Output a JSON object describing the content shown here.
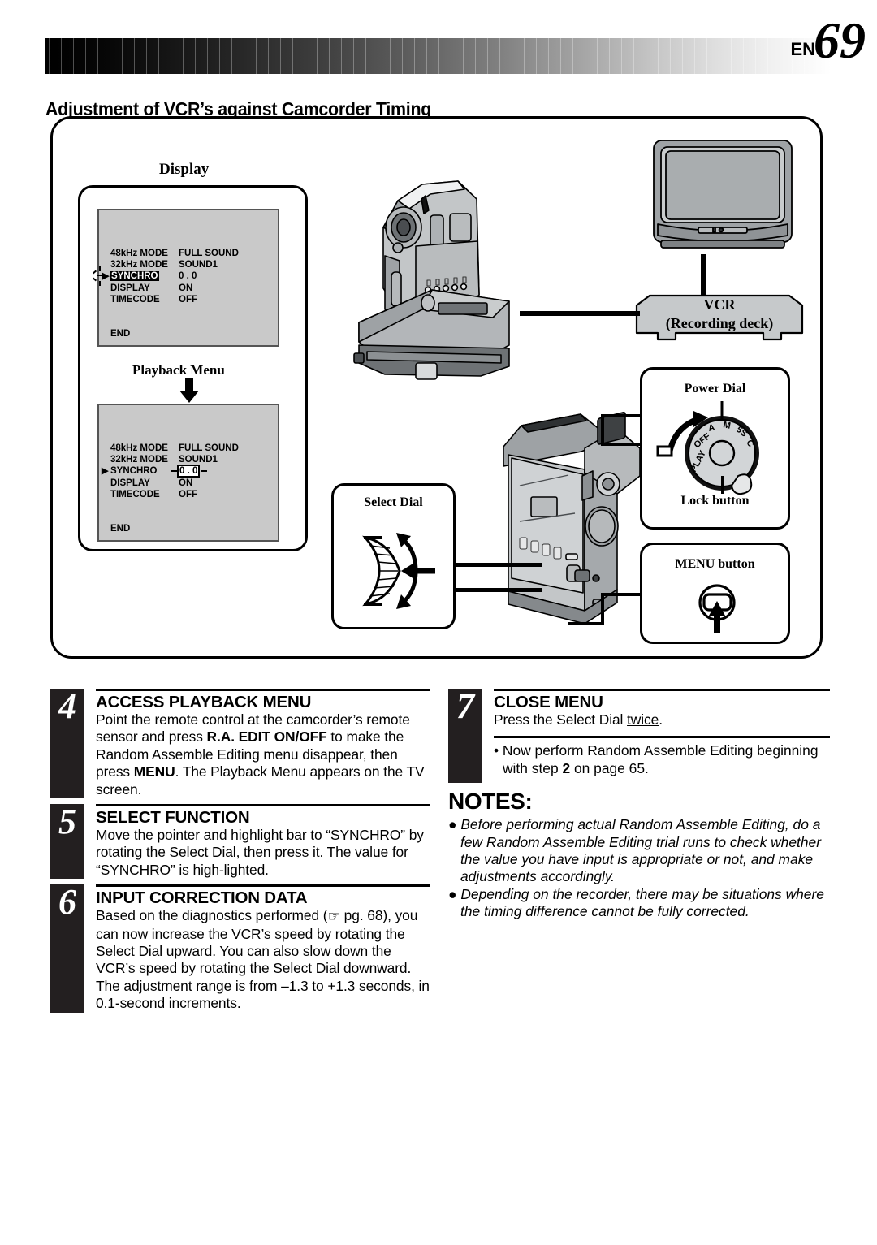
{
  "header": {
    "en_label": "EN",
    "page_number": "69",
    "section_title": "Adjustment of VCR’s against Camcorder Timing"
  },
  "illustration": {
    "display_label": "Display",
    "playback_menu_label": "Playback Menu",
    "osd_display": {
      "rows": [
        {
          "label": "48kHz  MODE",
          "value": "FULL SOUND",
          "state": "normal"
        },
        {
          "label": "32kHz  MODE",
          "value": "SOUND1",
          "state": "normal"
        },
        {
          "label": "SYNCHRO",
          "value": "0 . 0",
          "state": "highlighted-label"
        },
        {
          "label": "DISPLAY",
          "value": "ON",
          "state": "normal"
        },
        {
          "label": "TIMECODE",
          "value": "OFF",
          "state": "normal"
        }
      ],
      "end_label": "END",
      "pointer_row": 2
    },
    "osd_playback": {
      "rows": [
        {
          "label": "48kHz  MODE",
          "value": "FULL SOUND",
          "state": "normal"
        },
        {
          "label": "32kHz  MODE",
          "value": "SOUND1",
          "state": "normal"
        },
        {
          "label": "SYNCHRO",
          "value": "0 . 0",
          "state": "boxed-value"
        },
        {
          "label": "DISPLAY",
          "value": "ON",
          "state": "normal"
        },
        {
          "label": "TIMECODE",
          "value": "OFF",
          "state": "normal"
        }
      ],
      "end_label": "END",
      "pointer_row": 2
    },
    "vcr_line1": "VCR",
    "vcr_line2": "(Recording deck)",
    "power_dial_label": "Power Dial",
    "lock_button_label": "Lock button",
    "menu_button_label": "MENU button",
    "select_dial_label": "Select Dial",
    "power_dial_positions": [
      "PLAY",
      "OFF",
      "A",
      "M",
      "5S",
      "C"
    ],
    "colors": {
      "device_body": "#b0b3b5",
      "device_dark": "#7b7f82",
      "osd_bg": "#c9c9c9"
    }
  },
  "steps": [
    {
      "number": "4",
      "title": "ACCESS PLAYBACK MENU",
      "body_parts": [
        {
          "t": "Point the remote control at the camcorder’s remote sensor and press ",
          "b": false
        },
        {
          "t": "R.A. EDIT ON/OFF",
          "b": true
        },
        {
          "t": " to make the Random Assemble Editing menu disappear, then press ",
          "b": false
        },
        {
          "t": "MENU",
          "b": true
        },
        {
          "t": ". The Playback Menu appears on the TV screen.",
          "b": false
        }
      ]
    },
    {
      "number": "5",
      "title": "SELECT FUNCTION",
      "body_parts": [
        {
          "t": "Move the pointer and highlight bar to “SYNCHRO” by rotating the Select Dial, then press it. The value for “SYNCHRO” is high-lighted.",
          "b": false
        }
      ]
    },
    {
      "number": "6",
      "title": "INPUT CORRECTION DATA",
      "body_parts": [
        {
          "t": "Based on the diagnostics performed (",
          "b": false
        },
        {
          "t": "☞",
          "b": false,
          "icon": "pointing-hand-icon"
        },
        {
          "t": " pg. 68), you can now increase the VCR’s speed by rotating the Select Dial upward. You can also slow down the VCR’s speed by rotating the Select Dial downward. The adjustment range is from –1.3 to +1.3 seconds, in 0.1-second increments.",
          "b": false
        }
      ]
    },
    {
      "number": "7",
      "title": "CLOSE MENU",
      "body_parts": [
        {
          "t": "Press the Select Dial ",
          "b": false
        },
        {
          "t": "twice",
          "b": false,
          "u": true
        },
        {
          "t": ".",
          "b": false
        }
      ]
    }
  ],
  "after_step_bullet": {
    "text_1": "• Now perform Random Assemble Editing beginning with step ",
    "bold_step": "2",
    "text_2": " on page 65."
  },
  "notes": {
    "title": "NOTES:",
    "items": [
      "● Before performing actual Random Assemble Editing, do a few Random Assemble Editing trial runs to check whether the value you have input is appropriate or not, and make adjustments accordingly.",
      "● Depending on the recorder, there may be situations where the timing difference cannot be fully corrected."
    ]
  }
}
